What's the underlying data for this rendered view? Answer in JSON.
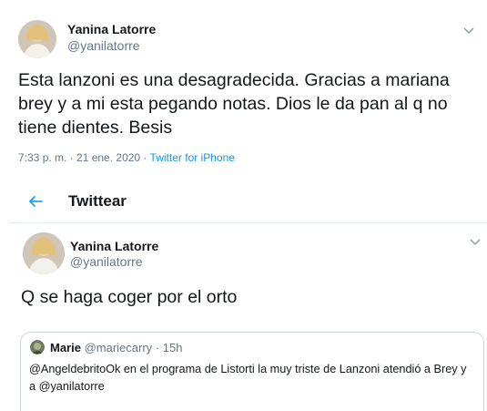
{
  "tweet1": {
    "author_name": "Yanina Latorre",
    "author_handle": "@yanilatorre",
    "text": "Esta lanzoni es una desagradecida. Gracias a mariana brey y a mi esta pegando notas. Dios le da pan al q no tiene dientes. Besis",
    "time": "7:33 p. m. · 21 ene. 2020",
    "separator": " · ",
    "source": "Twitter for iPhone"
  },
  "header": {
    "title": "Twittear"
  },
  "tweet2": {
    "author_name": "Yanina Latorre",
    "author_handle": "@yanilatorre",
    "text": "Q se haga coger por el orto",
    "quoted": {
      "name": "Marie",
      "handle": "@mariecarry",
      "time": "· 15h",
      "text": "@AngeldebritoOk en el programa de Listorti la muy triste de Lanzoni atendió a Brey y a @yanilatorre"
    }
  },
  "icons": {
    "caret": "chevron-down-icon",
    "back": "back-arrow-icon"
  },
  "colors": {
    "accent": "#1b95e0",
    "muted": "#657786",
    "border": "#e6ecf0"
  }
}
